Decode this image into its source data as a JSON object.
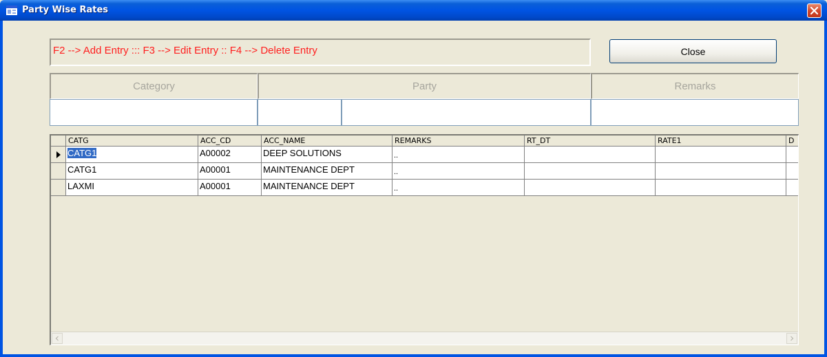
{
  "window": {
    "title": "Party Wise Rates"
  },
  "hint": {
    "text": "F2 --> Add Entry  :::  F3 --> Edit Entry  ::  F4 --> Delete Entry"
  },
  "buttons": {
    "close_label": "Close"
  },
  "headers": {
    "category": "Category",
    "party": "Party",
    "remarks": "Remarks"
  },
  "grid": {
    "columns": [
      "CATG",
      "ACC_CD",
      "ACC_NAME",
      "REMARKS",
      "RT_DT",
      "RATE1",
      "D"
    ],
    "rows": [
      {
        "catg": "CATG1",
        "acc_cd": "A00002",
        "acc_name": "DEEP SOLUTIONS",
        "remarks": "..",
        "rt_dt": "",
        "rate1": "",
        "current": true
      },
      {
        "catg": "CATG1",
        "acc_cd": "A00001",
        "acc_name": "MAINTENANCE DEPT",
        "remarks": "..",
        "rt_dt": "",
        "rate1": "",
        "current": false
      },
      {
        "catg": "LAXMI",
        "acc_cd": "A00001",
        "acc_name": "MAINTENANCE DEPT",
        "remarks": "..",
        "rt_dt": "",
        "rate1": "",
        "current": false
      }
    ]
  },
  "colors": {
    "title_bar": "#0054e3",
    "hint_text": "#ff1f1f",
    "selection": "#316ac5",
    "window_bg": "#ece9d8"
  },
  "icons": {
    "app": "app-window-icon",
    "close": "close-x-icon",
    "row_pointer": "triangle-right-icon",
    "scroll_left": "chevron-left-icon",
    "scroll_right": "chevron-right-icon"
  }
}
